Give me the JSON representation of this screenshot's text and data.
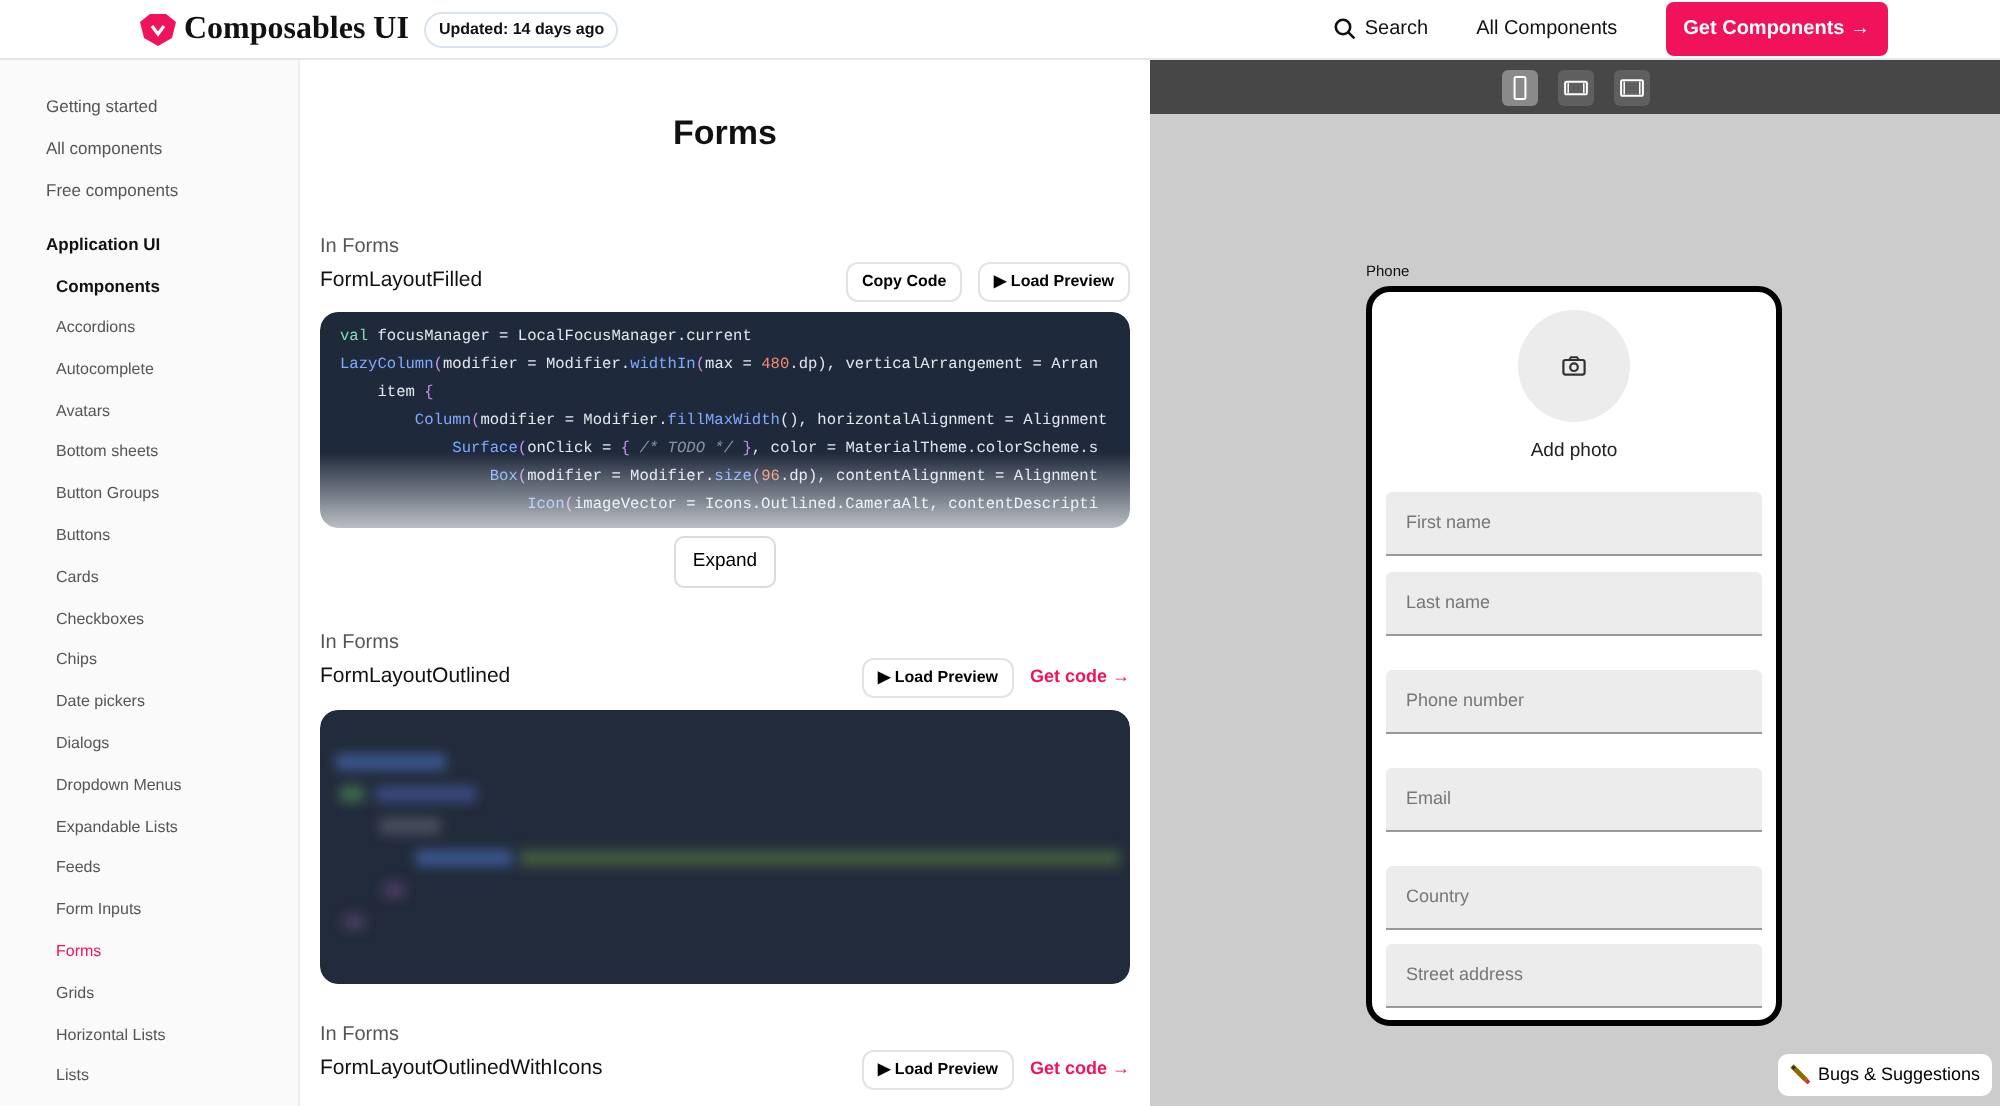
{
  "header": {
    "brand": "Composables UI",
    "updated_badge": "Updated: 14 days ago",
    "nav": [
      {
        "label": "Search",
        "kind": "search"
      },
      {
        "label": "All Components",
        "kind": "link"
      },
      {
        "label": "Get Components →",
        "kind": "primary"
      }
    ]
  },
  "sidebar": {
    "top_links": [
      "Getting started",
      "All components",
      "Free components"
    ],
    "section": "Application UI",
    "group": "Components",
    "items": [
      {
        "label": "Accordions",
        "selected": false
      },
      {
        "label": "Autocomplete",
        "selected": false
      },
      {
        "label": "Avatars",
        "selected": false
      },
      {
        "label": "Bottom sheets",
        "selected": false
      },
      {
        "label": "Button Groups",
        "selected": false
      },
      {
        "label": "Buttons",
        "selected": false
      },
      {
        "label": "Cards",
        "selected": false
      },
      {
        "label": "Checkboxes",
        "selected": false
      },
      {
        "label": "Chips",
        "selected": false
      },
      {
        "label": "Date pickers",
        "selected": false
      },
      {
        "label": "Dialogs",
        "selected": false
      },
      {
        "label": "Dropdown Menus",
        "selected": false
      },
      {
        "label": "Expandable Lists",
        "selected": false
      },
      {
        "label": "Feeds",
        "selected": false
      },
      {
        "label": "Form Inputs",
        "selected": false
      },
      {
        "label": "Forms",
        "selected": true
      },
      {
        "label": "Grids",
        "selected": false
      },
      {
        "label": "Horizontal Lists",
        "selected": false
      },
      {
        "label": "Lists",
        "selected": false
      }
    ]
  },
  "page_title": "Forms",
  "components": [
    {
      "kind": "code",
      "category": "In Forms",
      "title": "FormLayoutFilled",
      "actions": [
        {
          "label": "Copy Code",
          "kind": "button"
        },
        {
          "label": "▶ Load Preview",
          "kind": "button"
        }
      ],
      "code_lines": [
        [
          {
            "text": "val",
            "kind": "keyword"
          },
          {
            "text": " focusManager = LocalFocusManager.current",
            "kind": "plain"
          }
        ],
        [
          {
            "text": "LazyColumn",
            "kind": "call"
          },
          {
            "text": "(",
            "kind": "punct"
          },
          {
            "text": "modifier = Modifier.",
            "kind": "plain"
          },
          {
            "text": "widthIn",
            "kind": "call"
          },
          {
            "text": "(",
            "kind": "punct"
          },
          {
            "text": "max = ",
            "kind": "plain"
          },
          {
            "text": "480",
            "kind": "number"
          },
          {
            "text": ".dp), verticalArrangement = Arran",
            "kind": "plain"
          }
        ],
        [
          {
            "text": "    item ",
            "kind": "plain"
          },
          {
            "text": "{",
            "kind": "punct"
          }
        ],
        [
          {
            "text": "        Column",
            "kind": "call"
          },
          {
            "text": "(",
            "kind": "punct"
          },
          {
            "text": "modifier = Modifier.",
            "kind": "plain"
          },
          {
            "text": "fillMaxWidth",
            "kind": "call"
          },
          {
            "text": "(), horizontalAlignment = Alignment",
            "kind": "plain"
          }
        ],
        [
          {
            "text": "            Surface",
            "kind": "call"
          },
          {
            "text": "(",
            "kind": "punct"
          },
          {
            "text": "onClick = ",
            "kind": "plain"
          },
          {
            "text": "{ ",
            "kind": "punct"
          },
          {
            "text": "/* TODO */",
            "kind": "comment"
          },
          {
            "text": " }",
            "kind": "punct"
          },
          {
            "text": ", color = MaterialTheme.colorScheme.s",
            "kind": "plain"
          }
        ],
        [
          {
            "text": "                Box",
            "kind": "call"
          },
          {
            "text": "(",
            "kind": "punct"
          },
          {
            "text": "modifier = Modifier.",
            "kind": "plain"
          },
          {
            "text": "size",
            "kind": "call"
          },
          {
            "text": "(",
            "kind": "punct"
          },
          {
            "text": "96",
            "kind": "number"
          },
          {
            "text": ".dp), contentAlignment = Alignment",
            "kind": "plain"
          }
        ],
        [
          {
            "text": "                    Icon",
            "kind": "call"
          },
          {
            "text": "(",
            "kind": "punct"
          },
          {
            "text": "imageVector = Icons.Outlined.CameraAlt, contentDescripti",
            "kind": "plain"
          }
        ]
      ],
      "expand": "Expand"
    },
    {
      "kind": "locked",
      "category": "In Forms",
      "title": "FormLayoutOutlined",
      "actions": [
        {
          "label": "▶ Load Preview",
          "kind": "button"
        },
        {
          "label": "Get code →",
          "kind": "link"
        }
      ]
    },
    {
      "kind": "header_only",
      "category": "In Forms",
      "title": "FormLayoutOutlinedWithIcons",
      "actions": [
        {
          "label": "▶ Load Preview",
          "kind": "button"
        },
        {
          "label": "Get code →",
          "kind": "link"
        }
      ]
    }
  ],
  "preview": {
    "devices": [
      {
        "kind": "phone",
        "selected": true
      },
      {
        "kind": "tablet",
        "selected": false
      },
      {
        "kind": "desktop",
        "selected": false
      }
    ],
    "device_label": "Phone",
    "add_photo": "Add photo",
    "fields": [
      {
        "placeholder": "First name"
      },
      {
        "placeholder": "Last name"
      },
      {
        "placeholder": "Phone number"
      },
      {
        "placeholder": "Email"
      },
      {
        "placeholder": "Country"
      },
      {
        "placeholder": "Street address"
      }
    ],
    "feedback_button": "Bugs & Suggestions"
  }
}
